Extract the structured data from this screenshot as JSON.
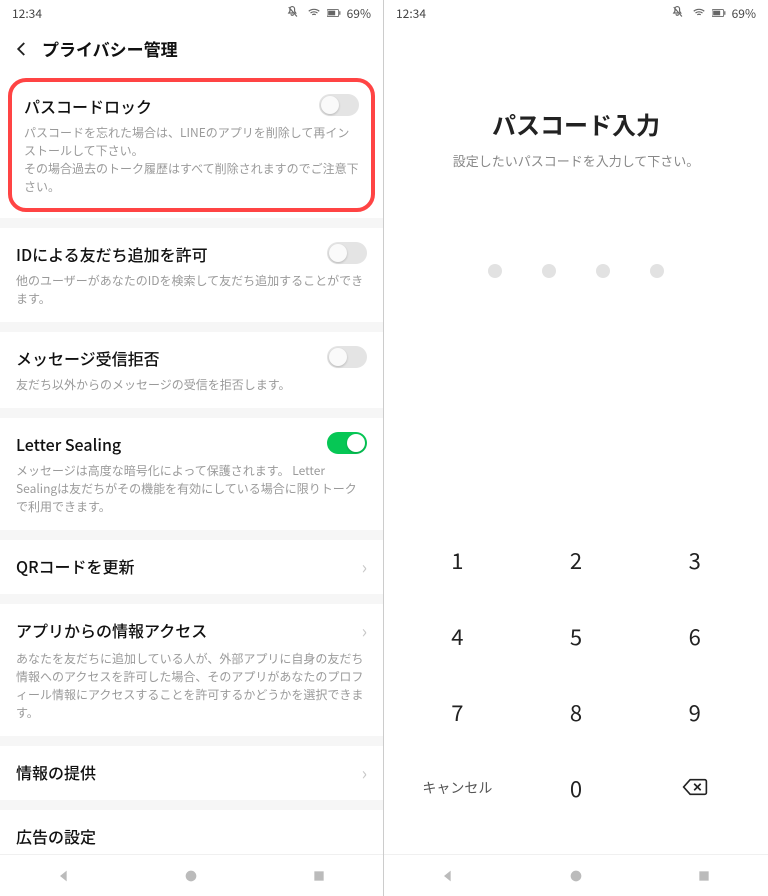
{
  "status": {
    "time": "12:34",
    "battery": "69%"
  },
  "left": {
    "header_title": "プライバシー管理",
    "passcode_lock_title": "パスコードロック",
    "passcode_lock_desc": "パスコードを忘れた場合は、LINEのアプリを削除して再インストールして下さい。\nその場合過去のトーク履歴はすべて削除されますのでご注意下さい。",
    "id_add_title": "IDによる友だち追加を許可",
    "id_add_desc": "他のユーザーがあなたのIDを検索して友だち追加することができます。",
    "msg_reject_title": "メッセージ受信拒否",
    "msg_reject_desc": "友だち以外からのメッセージの受信を拒否します。",
    "letter_sealing_title": "Letter Sealing",
    "letter_sealing_desc": "メッセージは高度な暗号化によって保護されます。 Letter Sealingは友だちがその機能を有効にしている場合に限りトークで利用できます。",
    "qr_refresh_title": "QRコードを更新",
    "app_access_title": "アプリからの情報アクセス",
    "app_access_desc": "あなたを友だちに追加している人が、外部アプリに自身の友だち情報へのアクセスを許可した場合、そのアプリがあなたのプロフィール情報にアクセスすることを許可するかどうかを選択できます。",
    "info_provide_title": "情報の提供",
    "ad_settings_title": "広告の設定"
  },
  "right": {
    "entry_title": "パスコード入力",
    "entry_sub": "設定したいパスコードを入力して下さい。",
    "cancel": "キャンセル",
    "k1": "1",
    "k2": "2",
    "k3": "3",
    "k4": "4",
    "k5": "5",
    "k6": "6",
    "k7": "7",
    "k8": "8",
    "k9": "9",
    "k0": "0"
  }
}
